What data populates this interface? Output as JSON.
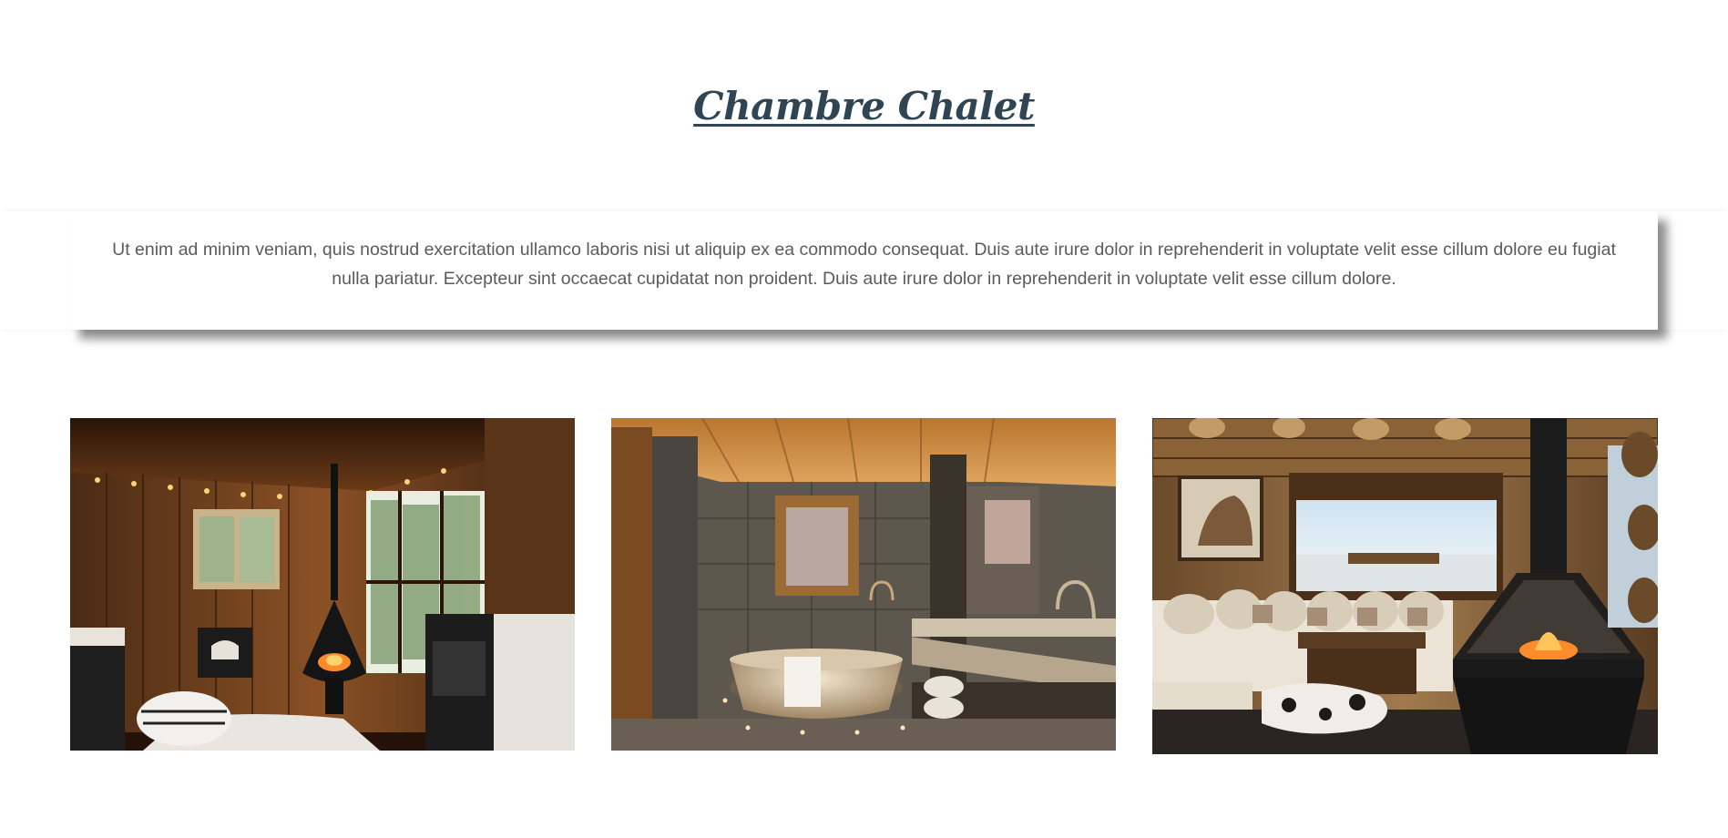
{
  "header": {
    "title": "Chambre Chalet"
  },
  "intro": {
    "text": "Ut enim ad minim veniam, quis nostrud exercitation ullamco laboris nisi ut aliquip ex ea commodo consequat. Duis aute irure dolor in reprehenderit in voluptate velit esse cillum dolore eu fugiat nulla pariatur. Excepteur sint occaecat cupidatat non proident. Duis aute irure dolor in reprehenderit in voluptate velit esse cillum dolore."
  },
  "gallery": {
    "images": [
      {
        "name": "chalet-living-room-photo"
      },
      {
        "name": "chalet-bathroom-photo"
      },
      {
        "name": "chalet-lounge-fireplace-photo"
      }
    ]
  },
  "colors": {
    "title": "#2f4553",
    "body_text": "#5b5b5b",
    "background": "#ffffff"
  }
}
